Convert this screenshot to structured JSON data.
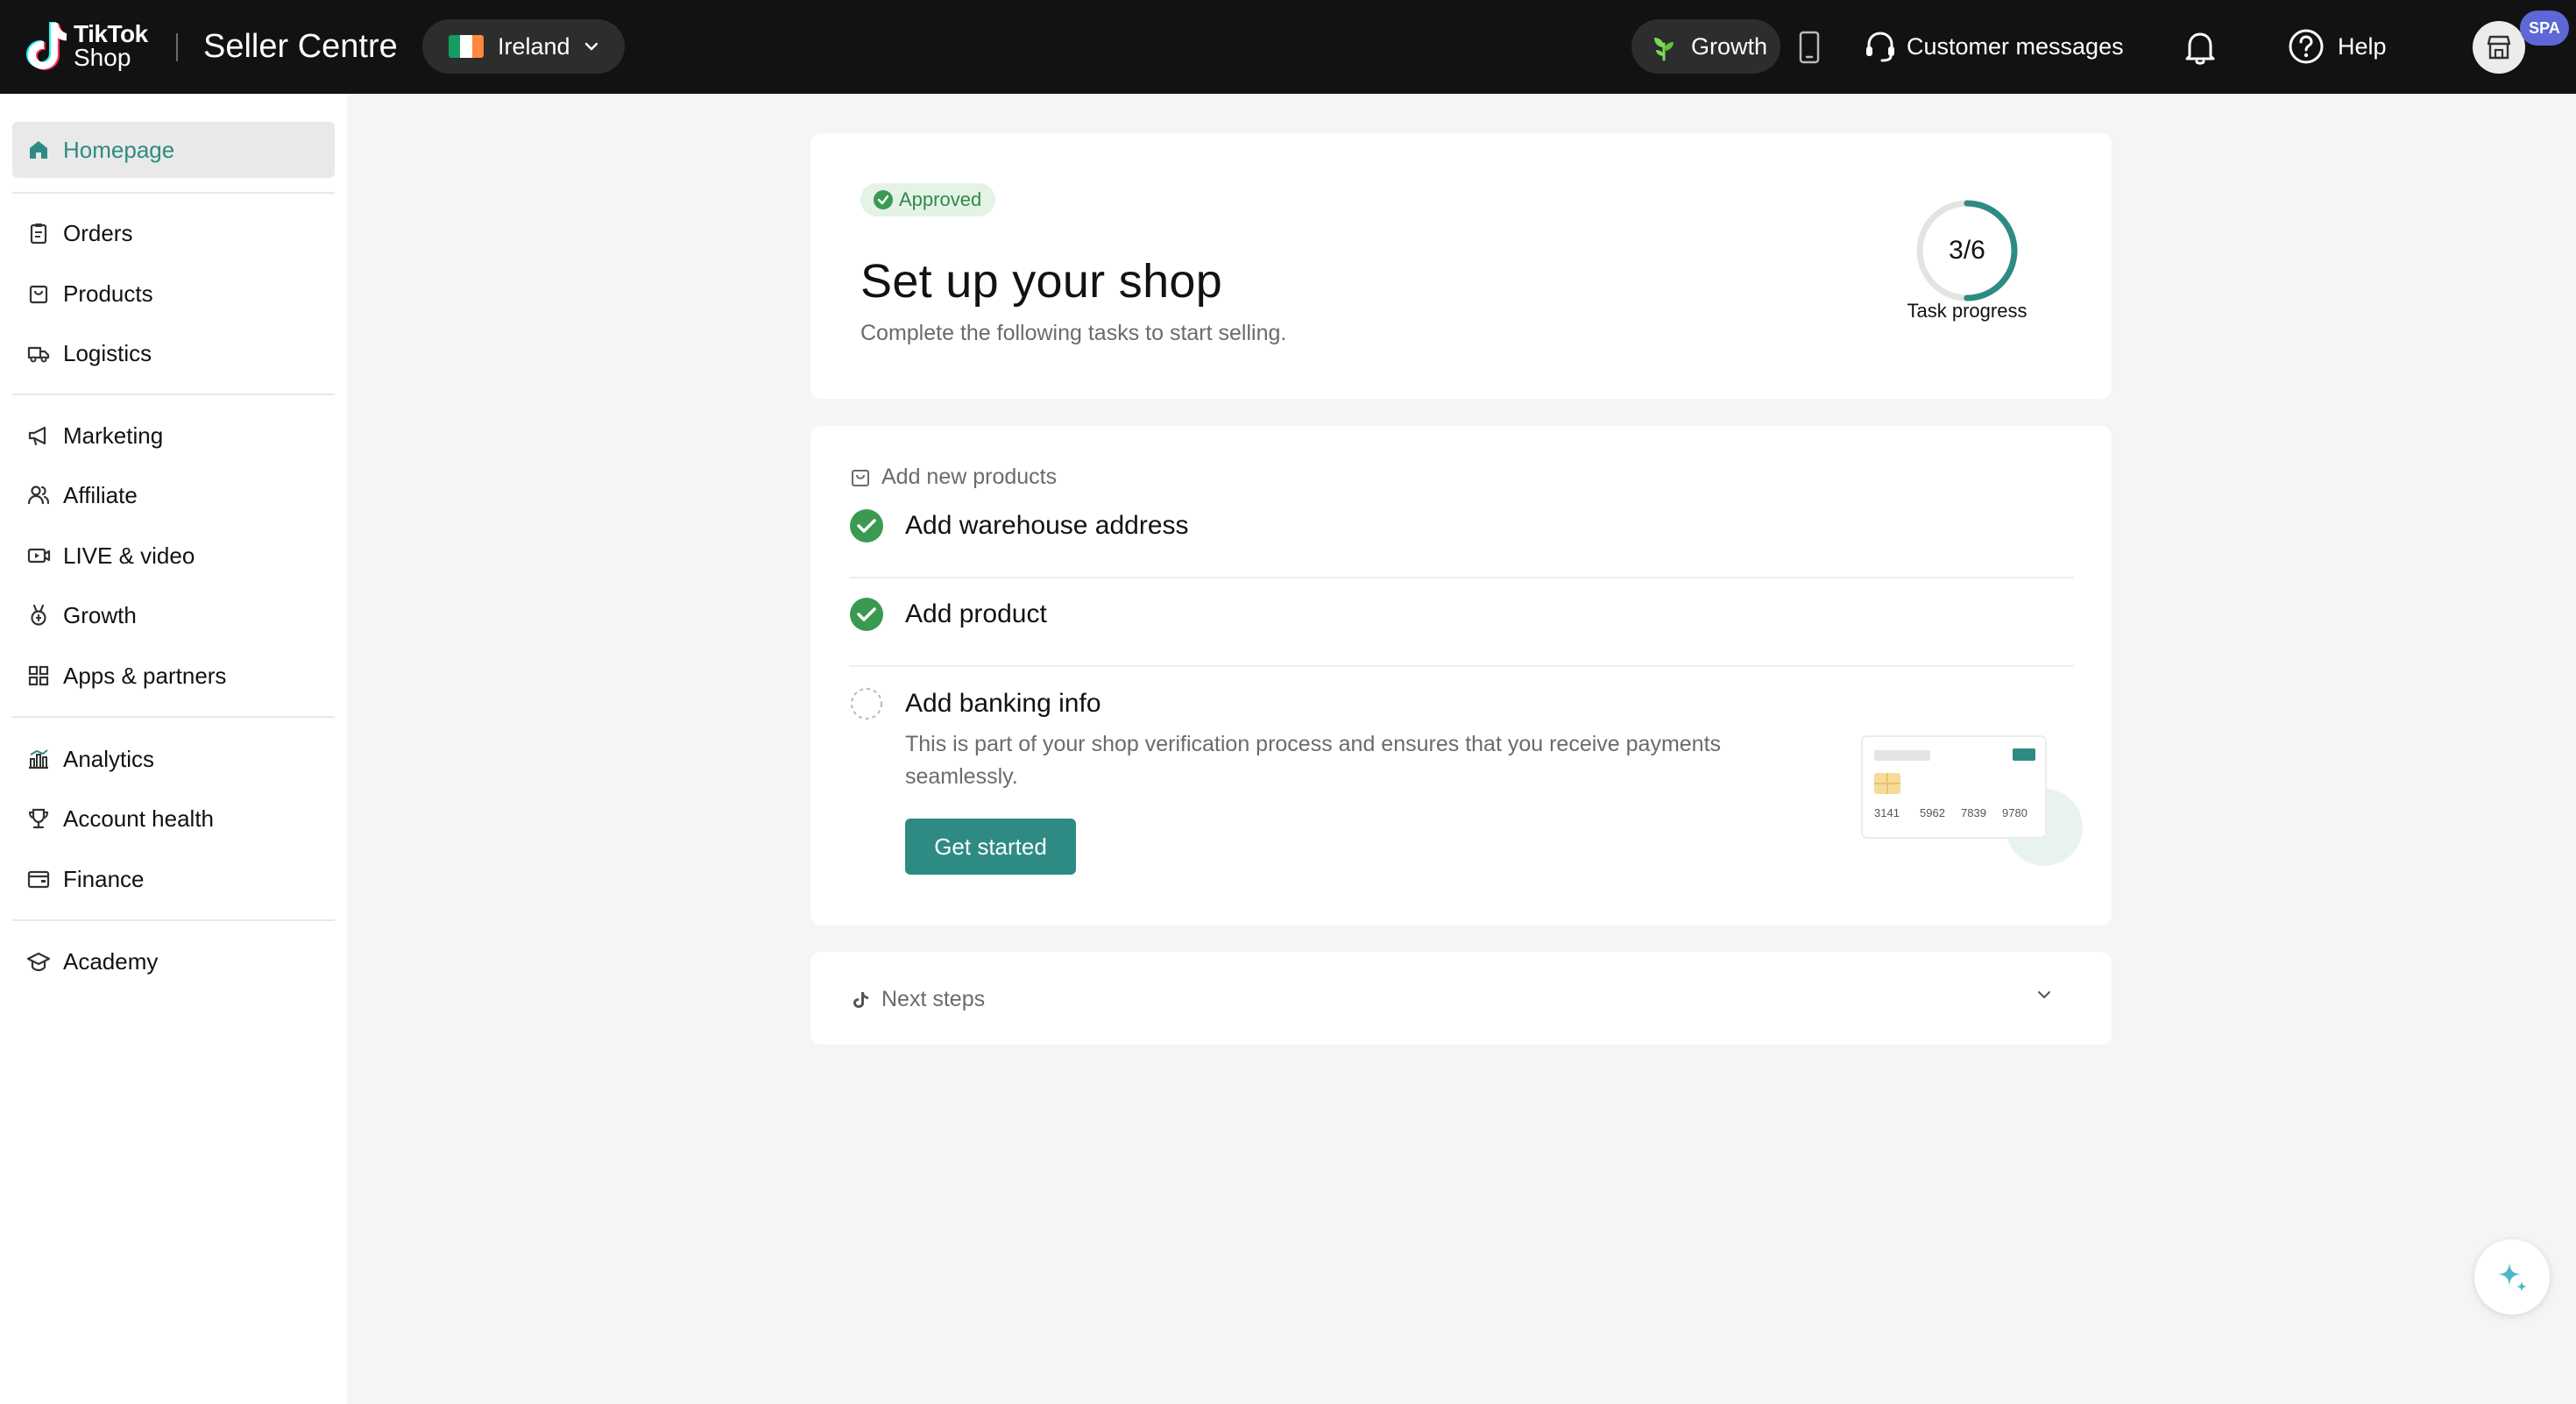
{
  "header": {
    "logo_line1": "TikTok",
    "logo_line2": "Shop",
    "app_title": "Seller Centre",
    "region": "Ireland",
    "growth_label": "Growth",
    "customer_messages": "Customer messages",
    "help": "Help",
    "avatar_badge": "SPA"
  },
  "sidebar": {
    "items": [
      {
        "label": "Homepage",
        "icon": "home-icon",
        "active": true
      },
      {
        "label": "Orders",
        "icon": "clipboard-icon"
      },
      {
        "label": "Products",
        "icon": "bag-icon"
      },
      {
        "label": "Logistics",
        "icon": "truck-icon"
      },
      {
        "label": "Marketing",
        "icon": "megaphone-icon"
      },
      {
        "label": "Affiliate",
        "icon": "people-icon"
      },
      {
        "label": "LIVE & video",
        "icon": "video-icon"
      },
      {
        "label": "Growth",
        "icon": "medal-icon"
      },
      {
        "label": "Apps & partners",
        "icon": "apps-icon"
      },
      {
        "label": "Analytics",
        "icon": "bar-chart-icon"
      },
      {
        "label": "Account health",
        "icon": "trophy-icon"
      },
      {
        "label": "Finance",
        "icon": "wallet-icon"
      },
      {
        "label": "Academy",
        "icon": "graduation-cap-icon"
      }
    ]
  },
  "setup": {
    "badge": "Approved",
    "title": "Set up your shop",
    "subtitle": "Complete the following tasks to start selling.",
    "progress_text": "3/6",
    "progress_fraction": 0.5,
    "progress_label": "Task progress"
  },
  "tasks": {
    "section_title": "Add new products",
    "items": [
      {
        "label": "Add warehouse address",
        "done": true
      },
      {
        "label": "Add product",
        "done": true
      },
      {
        "label": "Add banking info",
        "done": false
      }
    ],
    "banking_desc": "This is part of your shop verification process and ensures that you receive payments seamlessly.",
    "cta": "Get started",
    "card_numbers": [
      "3141",
      "5962",
      "7839",
      "9780"
    ]
  },
  "next_steps": {
    "title": "Next steps"
  },
  "colors": {
    "brand_teal": "#2e8b84",
    "success_green": "#3a9a52",
    "topbar": "#121212"
  }
}
